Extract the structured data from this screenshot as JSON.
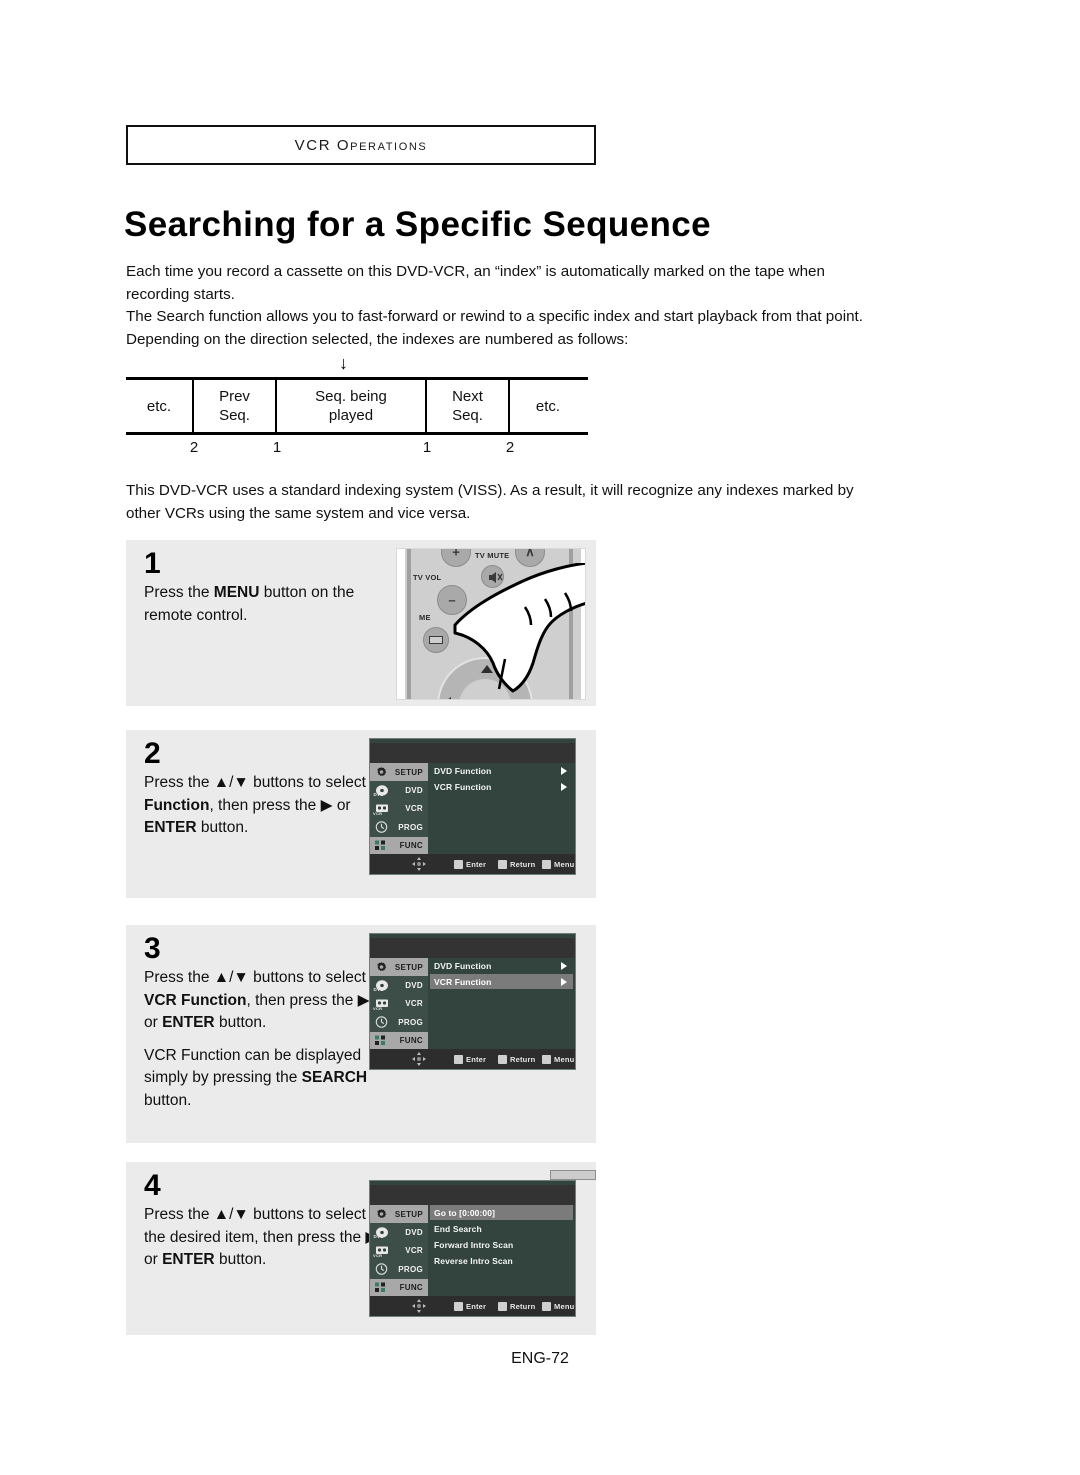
{
  "running_head": "VCR Operations",
  "title": "Searching for a Specific Sequence",
  "intro": {
    "line1": "Each time you record a cassette on this DVD-VCR, an “index” is automatically marked on the tape when",
    "line2": "recording starts.",
    "line3": "The Search function allows you to fast-forward or rewind to a specific index and start playback from that point.",
    "line4": "Depending on the direction selected, the indexes are numbered as follows:"
  },
  "index_table": {
    "arrow": "↓",
    "cells": [
      {
        "line1": "etc.",
        "line2": ""
      },
      {
        "line1": "Prev",
        "line2": "Seq."
      },
      {
        "line1": "Seq. being",
        "line2": "played"
      },
      {
        "line1": "Next",
        "line2": "Seq."
      },
      {
        "line1": "etc.",
        "line2": ""
      }
    ],
    "numbers": [
      "2",
      "1",
      "1",
      "2"
    ]
  },
  "paragraph2": {
    "line1": "This DVD-VCR uses a standard indexing system (VISS). As a result, it will recognize any indexes marked by",
    "line2": "other VCRs using the same system and vice versa."
  },
  "steps": [
    {
      "number": "1",
      "text_parts": {
        "p1a": "Press the ",
        "p1b": "MENU",
        "p1c": " button on the remote control."
      }
    },
    {
      "number": "2",
      "text_parts": {
        "p1a": "Press the ▲/▼ buttons to select ",
        "p1b": "Function",
        "p1c": ", then press the ▶ or ",
        "p1d": "ENTER",
        "p1e": " button."
      }
    },
    {
      "number": "3",
      "text_parts": {
        "p1a": "Press the ▲/▼ buttons to select ",
        "p1b": "VCR Function",
        "p1c": ", then press the ▶ or ",
        "p1d": "ENTER",
        "p1e": " button.",
        "p2a": "VCR Function can be displayed simply by pressing the ",
        "p2b": "SEARCH",
        "p2c": " button."
      }
    },
    {
      "number": "4",
      "text_parts": {
        "p1a": "Press the ▲/▼ buttons to select the desired item, then press the ▶ or ",
        "p1b": "ENTER",
        "p1c": " button."
      }
    }
  ],
  "remote": {
    "label_tv_mute": "TV MUTE",
    "label_tv_vol": "TV VOL",
    "label_menu": "ME",
    "plus_glyph": "+",
    "minus_glyph": "–",
    "ch_glyph": "∧"
  },
  "osd": {
    "sidebar": [
      {
        "label": "SETUP",
        "icon": "gear-icon",
        "state": "on"
      },
      {
        "label": "DVD",
        "icon": "disc-icon",
        "state": "dim"
      },
      {
        "label": "VCR",
        "icon": "cassette-icon",
        "state": "dim"
      },
      {
        "label": "PROG",
        "icon": "clock-icon",
        "state": "dim"
      },
      {
        "label": "FUNC",
        "icon": "blocks-icon",
        "state": "on"
      }
    ],
    "footer": {
      "nav_icon": "dpad-icon",
      "enter": "Enter",
      "return": "Return",
      "menu": "Menu"
    },
    "menu_step2": {
      "rows": [
        {
          "label": "DVD Function",
          "arrow": true,
          "selected": false
        },
        {
          "label": "VCR Function",
          "arrow": true,
          "selected": false
        }
      ]
    },
    "menu_step3": {
      "rows": [
        {
          "label": "DVD Function",
          "arrow": true,
          "selected": false
        },
        {
          "label": "VCR Function",
          "arrow": true,
          "selected": true
        }
      ]
    },
    "menu_step4": {
      "rows": [
        {
          "label": "Go to [0:00:00]",
          "arrow": false,
          "selected": true
        },
        {
          "label": "End Search",
          "arrow": false,
          "selected": false
        },
        {
          "label": "Forward Intro Scan",
          "arrow": false,
          "selected": false
        },
        {
          "label": "Reverse Intro Scan",
          "arrow": false,
          "selected": false
        }
      ]
    }
  },
  "page_number": "ENG-72",
  "colors": {
    "step_bg": "#ebebeb",
    "osd_panel": "#33443f",
    "osd_topbar": "#333333",
    "osd_footer": "#2d2d2d",
    "osd_selected": "#7b7b7b",
    "osd_sidebar_active": "#a8a8a8"
  }
}
